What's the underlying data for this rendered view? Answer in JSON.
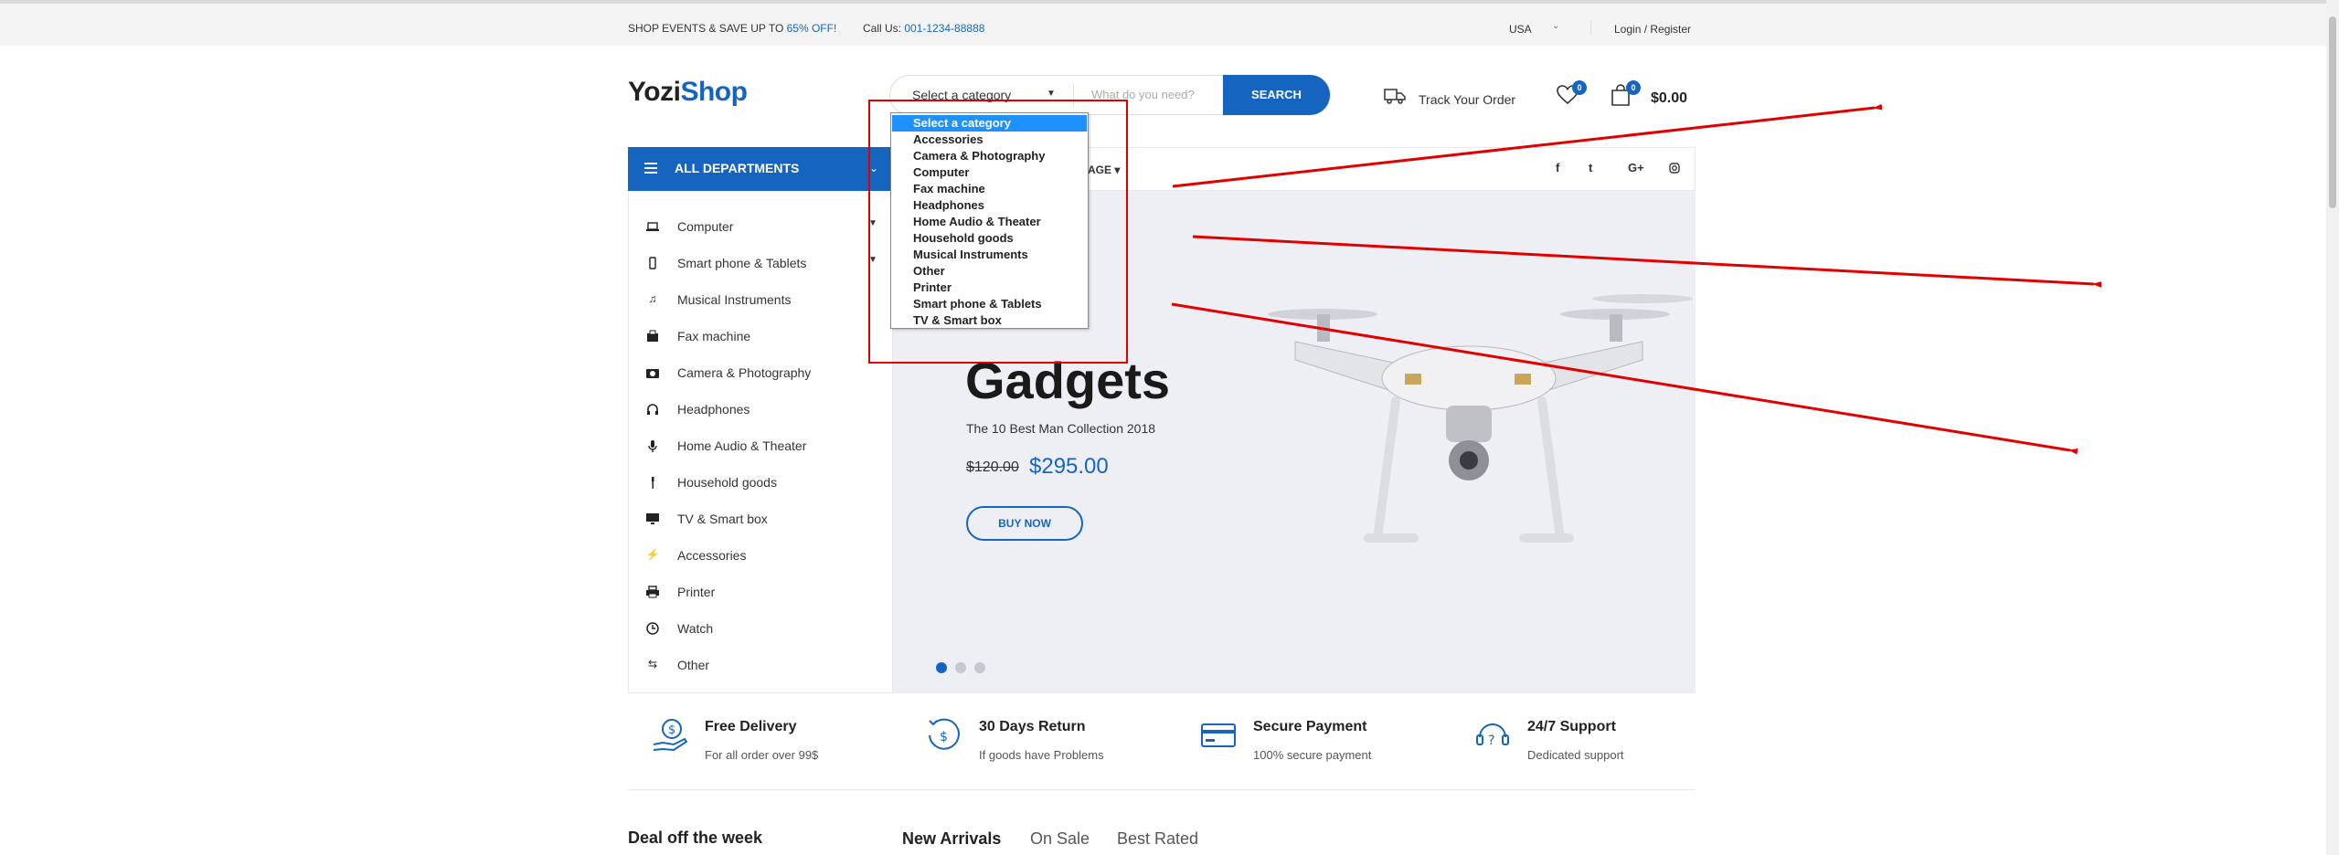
{
  "topbar": {
    "promo_text": "SHOP EVENTS & SAVE UP TO ",
    "promo_highlight": "65% OFF!",
    "call_label": "Call Us: ",
    "call_number": "001-1234-88888",
    "country": "USA",
    "login": "Login / Register"
  },
  "header": {
    "logo_part1": "Yozi",
    "logo_part2": "Shop",
    "search": {
      "category_value": "Select a category",
      "placeholder": "What do you need?",
      "button": "SEARCH"
    },
    "track_order": "Track Your Order",
    "wishlist_count": "0",
    "cart_count": "0",
    "cart_total": "$0.00"
  },
  "dropdown": {
    "options": [
      "Select a category",
      "Accessories",
      "Camera & Photography",
      "Computer",
      "Fax machine",
      "Headphones",
      "Home Audio & Theater",
      "Household goods",
      "Musical Instruments",
      "Other",
      "Printer",
      "Smart phone & Tablets",
      "TV & Smart box"
    ],
    "selected_index": 0
  },
  "departments": {
    "title": "ALL DEPARTMENTS",
    "items": [
      {
        "label": "Computer",
        "icon": "laptop-icon",
        "has_submenu": true
      },
      {
        "label": "Smart phone & Tablets",
        "icon": "smartphone-icon",
        "has_submenu": true
      },
      {
        "label": "Musical Instruments",
        "icon": "music-note-icon",
        "has_submenu": false
      },
      {
        "label": "Fax machine",
        "icon": "fax-icon",
        "has_submenu": false
      },
      {
        "label": "Camera & Photography",
        "icon": "camera-icon",
        "has_submenu": false
      },
      {
        "label": "Headphones",
        "icon": "headphones-icon",
        "has_submenu": false
      },
      {
        "label": "Home Audio & Theater",
        "icon": "microphone-icon",
        "has_submenu": false
      },
      {
        "label": "Household goods",
        "icon": "brush-icon",
        "has_submenu": false
      },
      {
        "label": "TV & Smart box",
        "icon": "monitor-icon",
        "has_submenu": false
      },
      {
        "label": "Accessories",
        "icon": "bolt-icon",
        "has_submenu": false
      },
      {
        "label": "Printer",
        "icon": "printer-icon",
        "has_submenu": false
      },
      {
        "label": "Watch",
        "icon": "clock-icon",
        "has_submenu": false
      },
      {
        "label": "Other",
        "icon": "shuffle-icon",
        "has_submenu": false
      }
    ]
  },
  "nav": {
    "partial_item": "AGE",
    "social": [
      "f",
      "t",
      "G+",
      "ig"
    ]
  },
  "hero": {
    "title": "Gadgets",
    "subtitle": "The 10 Best Man Collection 2018",
    "old_price": "$120.00",
    "new_price": "$295.00",
    "button": "BUY NOW",
    "slides": 3,
    "active_slide": 0
  },
  "features": [
    {
      "title": "Free Delivery",
      "desc": "For all order over 99$",
      "icon": "hand-money-icon"
    },
    {
      "title": "30 Days Return",
      "desc": "If goods have Problems",
      "icon": "return-money-icon"
    },
    {
      "title": "Secure Payment",
      "desc": "100% secure payment",
      "icon": "credit-card-icon"
    },
    {
      "title": "24/7 Support",
      "desc": "Dedicated support",
      "icon": "support-icon"
    }
  ],
  "bottom": {
    "deal_title": "Deal off the week",
    "tabs": [
      "New Arrivals",
      "On Sale",
      "Best Rated"
    ],
    "active_tab": 0
  },
  "colors": {
    "accent": "#1565c0",
    "annotation": "#e00000",
    "dropdown_highlight": "#1e90ff"
  }
}
